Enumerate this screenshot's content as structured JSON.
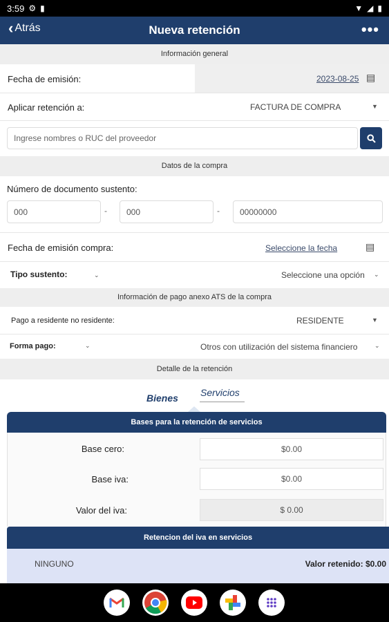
{
  "status": {
    "time": "3:59"
  },
  "appbar": {
    "back_label": "Atrás",
    "title": "Nueva retención",
    "more_label": "•••"
  },
  "general": {
    "section_title": "Información general",
    "fecha_label": "Fecha de emisión:",
    "fecha_value": "2023-08-25",
    "aplicar_label": "Aplicar retención a:",
    "aplicar_value": "FACTURA DE COMPRA",
    "proveedor_placeholder": "Ingrese nombres o RUC del proveedor"
  },
  "compra": {
    "section_title": "Datos de la compra",
    "doc_label": "Número de documento sustento:",
    "doc_part1": "000",
    "doc_part2": "000",
    "doc_part3": "00000000",
    "separator": "-",
    "fecha_label": "Fecha de emisión compra:",
    "fecha_link": "Seleccione la fecha",
    "tipo_label": "Tipo sustento:",
    "tipo_value": "Seleccione una opción"
  },
  "ats": {
    "section_title": "Información de pago anexo ATS de la compra",
    "pago_label": "Pago a residente no residente:",
    "pago_value": "RESIDENTE",
    "forma_label": "Forma pago:",
    "forma_value": "Otros con utilización del sistema financiero"
  },
  "detalle": {
    "section_title": "Detalle de la retención",
    "tabs": [
      "Bienes",
      "Servicios"
    ],
    "card_title": "Bases para la retención de servicios",
    "base_cero_label": "Base cero:",
    "base_cero_value": "$0.00",
    "base_iva_label": "Base iva:",
    "base_iva_value": "$0.00",
    "valor_iva_label": "Valor del iva:",
    "valor_iva_value": "$ 0.00",
    "retencion_title": "Retencion del iva en servicios",
    "retencion_option": "NINGUNO",
    "valor_retenido": "Valor retenido: $0.00"
  },
  "colors": {
    "primary": "#1f3e6c",
    "section_bg": "#eeeeee",
    "retention_bg": "#dde3f6"
  },
  "dock_apps": [
    "gmail",
    "chrome",
    "youtube",
    "photos",
    "app-drawer"
  ]
}
